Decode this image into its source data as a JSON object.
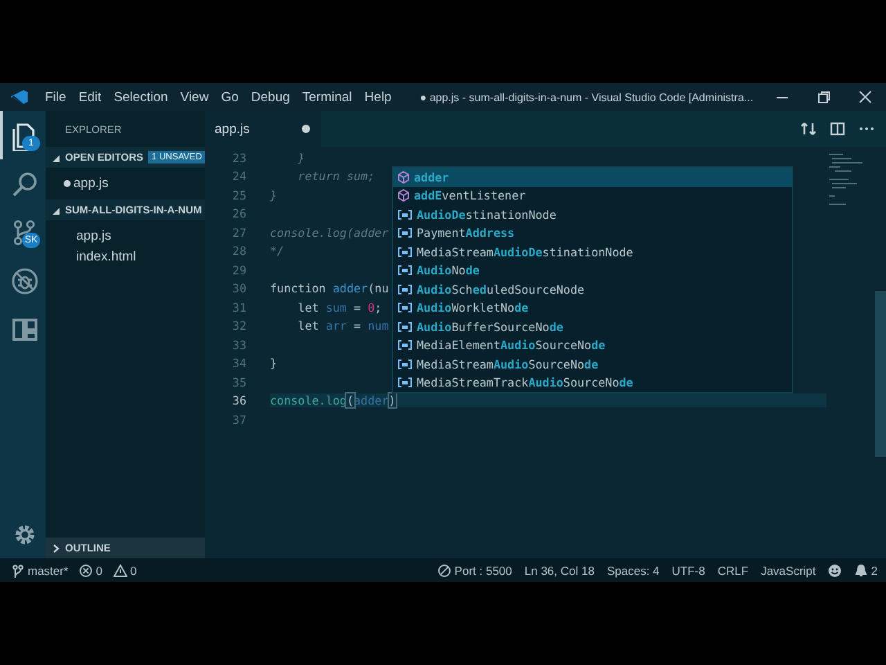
{
  "title_bar": {
    "menu": [
      "File",
      "Edit",
      "Selection",
      "View",
      "Go",
      "Debug",
      "Terminal",
      "Help"
    ],
    "title": "● app.js - sum-all-digits-in-a-num - Visual Studio Code [Administra..."
  },
  "activity_bar": {
    "items": [
      {
        "kind": "files",
        "selected": true,
        "badge": "1"
      },
      {
        "kind": "search",
        "selected": false
      },
      {
        "kind": "source-control",
        "selected": false,
        "badge": "SK"
      },
      {
        "kind": "debug",
        "selected": false
      },
      {
        "kind": "extensions",
        "selected": false
      }
    ]
  },
  "sidebar": {
    "title": "EXPLORER",
    "sections": [
      {
        "title": "OPEN EDITORS",
        "expanded": true,
        "badge": "1 UNSAVED",
        "items": [
          {
            "label": "app.js",
            "modified": true
          }
        ]
      },
      {
        "title": "SUM-ALL-DIGITS-IN-A-NUM",
        "expanded": true,
        "items": [
          {
            "label": "app.js",
            "modified": false
          },
          {
            "label": "index.html",
            "modified": false
          }
        ]
      }
    ],
    "footer_section": {
      "title": "OUTLINE",
      "expanded": false
    }
  },
  "tabs": [
    {
      "label": "app.js",
      "selected": true,
      "modified": true
    }
  ],
  "editor": {
    "lines": [
      {
        "number": "23",
        "current": false,
        "tokens": [
          {
            "text": "    }",
            "kind": "comment"
          }
        ]
      },
      {
        "number": "24",
        "current": false,
        "tokens": [
          {
            "text": "    return sum;",
            "kind": "comment"
          }
        ]
      },
      {
        "number": "25",
        "current": false,
        "tokens": [
          {
            "text": "}",
            "kind": "comment"
          }
        ]
      },
      {
        "number": "26",
        "current": false
      },
      {
        "number": "27",
        "current": false,
        "tokens": [
          {
            "text": "console.log(adder",
            "kind": "comment"
          }
        ]
      },
      {
        "number": "28",
        "current": false,
        "tokens": [
          {
            "text": "*/",
            "kind": "comment"
          }
        ]
      },
      {
        "number": "29",
        "current": false
      },
      {
        "number": "30",
        "current": false,
        "tokens": [
          {
            "text": "function ",
            "kind": "keyword"
          },
          {
            "text": "adder",
            "kind": "function"
          },
          {
            "text": "(nu",
            "kind": "plain"
          }
        ]
      },
      {
        "number": "31",
        "current": false,
        "tokens": [
          {
            "text": "    let ",
            "kind": "keyword"
          },
          {
            "text": "sum",
            "kind": "variable"
          },
          {
            "text": " = ",
            "kind": "plain"
          },
          {
            "text": "0",
            "kind": "number"
          },
          {
            "text": ";",
            "kind": "plain"
          }
        ]
      },
      {
        "number": "32",
        "current": false,
        "tokens": [
          {
            "text": "    let ",
            "kind": "keyword"
          },
          {
            "text": "arr",
            "kind": "variable"
          },
          {
            "text": " = ",
            "kind": "plain"
          },
          {
            "text": "num",
            "kind": "variable"
          }
        ]
      },
      {
        "number": "33",
        "current": false
      },
      {
        "number": "34",
        "current": false,
        "tokens": [
          {
            "text": "}",
            "kind": "plain"
          }
        ]
      },
      {
        "number": "35",
        "current": false
      },
      {
        "number": "36",
        "current": true,
        "tokens": [
          {
            "text": "console.log",
            "kind": "call"
          },
          {
            "text": "(",
            "kind": "bracket"
          },
          {
            "text": "adder",
            "kind": "variable"
          },
          {
            "text": ")",
            "kind": "bracket"
          }
        ]
      },
      {
        "number": "37",
        "current": false
      }
    ]
  },
  "suggestions": [
    {
      "kind": "method",
      "selected": true,
      "parts": [
        {
          "text": "adder",
          "matched": true
        }
      ]
    },
    {
      "kind": "method",
      "selected": false,
      "parts": [
        {
          "text": "addE",
          "matched": true
        },
        {
          "text": "ventListener",
          "matched": false
        }
      ]
    },
    {
      "kind": "variable",
      "selected": false,
      "parts": [
        {
          "text": "Audio",
          "matched": true
        },
        {
          "text": "De",
          "matched": true
        },
        {
          "text": "stinationNode",
          "matched": false
        }
      ]
    },
    {
      "kind": "variable",
      "selected": false,
      "parts": [
        {
          "text": "Payment",
          "matched": false
        },
        {
          "text": "Address",
          "matched": true
        }
      ]
    },
    {
      "kind": "variable",
      "selected": false,
      "parts": [
        {
          "text": "MediaStream",
          "matched": false
        },
        {
          "text": "Audio",
          "matched": true
        },
        {
          "text": "De",
          "matched": true
        },
        {
          "text": "stinationNode",
          "matched": false
        }
      ]
    },
    {
      "kind": "variable",
      "selected": false,
      "parts": [
        {
          "text": "Audio",
          "matched": true
        },
        {
          "text": "No",
          "matched": false
        },
        {
          "text": "de",
          "matched": true
        }
      ]
    },
    {
      "kind": "variable",
      "selected": false,
      "parts": [
        {
          "text": "Audio",
          "matched": true
        },
        {
          "text": "Sch",
          "matched": false
        },
        {
          "text": "ed",
          "matched": true
        },
        {
          "text": "uledSourceNode",
          "matched": false
        }
      ]
    },
    {
      "kind": "variable",
      "selected": false,
      "parts": [
        {
          "text": "Audio",
          "matched": true
        },
        {
          "text": "WorkletNo",
          "matched": false
        },
        {
          "text": "de",
          "matched": true
        }
      ]
    },
    {
      "kind": "variable",
      "selected": false,
      "parts": [
        {
          "text": "Audio",
          "matched": true
        },
        {
          "text": "BufferSourceNo",
          "matched": false
        },
        {
          "text": "de",
          "matched": true
        }
      ]
    },
    {
      "kind": "variable",
      "selected": false,
      "parts": [
        {
          "text": "MediaElement",
          "matched": false
        },
        {
          "text": "Audio",
          "matched": true
        },
        {
          "text": "SourceNo",
          "matched": false
        },
        {
          "text": "de",
          "matched": true
        }
      ]
    },
    {
      "kind": "variable",
      "selected": false,
      "parts": [
        {
          "text": "MediaStream",
          "matched": false
        },
        {
          "text": "Audio",
          "matched": true
        },
        {
          "text": "SourceNo",
          "matched": false
        },
        {
          "text": "de",
          "matched": true
        }
      ]
    },
    {
      "kind": "variable",
      "selected": false,
      "parts": [
        {
          "text": "MediaStreamTrack",
          "matched": false
        },
        {
          "text": "Audio",
          "matched": true
        },
        {
          "text": "SourceNo",
          "matched": false
        },
        {
          "text": "de",
          "matched": true
        }
      ]
    }
  ],
  "status_bar": {
    "left": [
      {
        "kind": "branch",
        "text": "master*"
      },
      {
        "kind": "errors",
        "text": "0"
      },
      {
        "kind": "warnings",
        "text": "0"
      }
    ],
    "right": [
      {
        "kind": "port",
        "text": "Port : 5500"
      },
      {
        "kind": "plain",
        "text": "Ln 36, Col 18"
      },
      {
        "kind": "plain",
        "text": "Spaces: 4"
      },
      {
        "kind": "plain",
        "text": "UTF-8"
      },
      {
        "kind": "plain",
        "text": "CRLF"
      },
      {
        "kind": "plain",
        "text": "JavaScript"
      },
      {
        "kind": "feedback"
      },
      {
        "kind": "notifications",
        "text": "2"
      }
    ]
  }
}
